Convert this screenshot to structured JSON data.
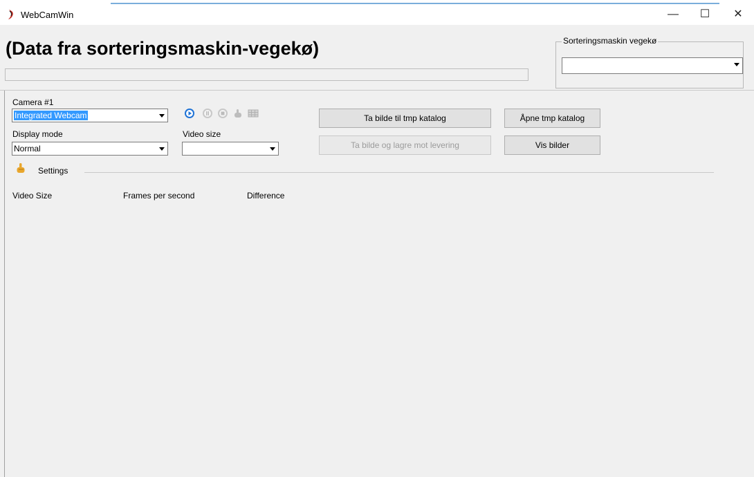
{
  "window": {
    "title": "WebCamWin",
    "controls": {
      "minimize": "—",
      "maximize": "☐",
      "close": "✕"
    }
  },
  "header": {
    "title": "(Data fra sorteringsmaskin-vegekø)",
    "progress": 0
  },
  "group": {
    "legend": "Sorteringsmaskin vegekø",
    "select_value": ""
  },
  "camera": {
    "label": "Camera #1",
    "selected": "Integrated Webcam"
  },
  "display_mode": {
    "label": "Display mode",
    "selected": "Normal"
  },
  "video_size": {
    "label": "Video size",
    "selected": ""
  },
  "media_icons": [
    "play-icon",
    "pause-icon",
    "stop-icon",
    "settings-hand-icon",
    "grid-icon"
  ],
  "buttons": {
    "take_tmp": "Ta bilde til tmp katalog",
    "take_save": "Ta bilde og lagre mot levering",
    "open_tmp": "Åpne tmp katalog",
    "show_images": "Vis bilder"
  },
  "settings": {
    "label": "Settings"
  },
  "stats": {
    "video_size": "Video Size",
    "fps": "Frames per second",
    "difference": "Difference"
  },
  "colors": {
    "accent": "#1e72d6",
    "selection": "#3399ff",
    "background": "#f0f0f0"
  }
}
